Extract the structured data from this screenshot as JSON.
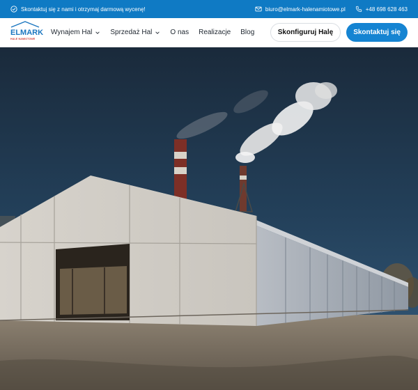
{
  "topbar": {
    "contact_prompt": "Skontaktuj się z nami i otrzymaj darmową wycenę!",
    "email": "biuro@elmark-halenamiotowe.pl",
    "phone": "+48 698 628 463"
  },
  "logo": {
    "brand": "ELMARK",
    "tagline": "HALE NAMIOTOWE"
  },
  "nav": {
    "items": [
      {
        "label": "Wynajem Hal",
        "dropdown": true
      },
      {
        "label": "Sprzedaż Hal",
        "dropdown": true
      },
      {
        "label": "O nas",
        "dropdown": false
      },
      {
        "label": "Realizacje",
        "dropdown": false
      },
      {
        "label": "Blog",
        "dropdown": false
      }
    ],
    "configure_button": "Skonfiguruj Halę",
    "contact_button": "Skontaktuj się"
  },
  "colors": {
    "topbar_bg": "#0f7ac4",
    "accent": "#1584d2",
    "logo_blue": "#1a76c0",
    "logo_red": "#d0302a"
  },
  "icons": {
    "contact": "check-circle-icon",
    "email": "mail-icon",
    "phone": "phone-icon",
    "dropdown": "chevron-down-icon"
  }
}
